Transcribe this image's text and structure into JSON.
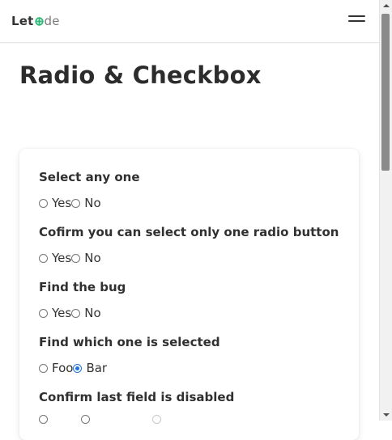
{
  "brand": {
    "part1": "Let",
    "part2": "de"
  },
  "page": {
    "title": "Radio & Checkbox"
  },
  "questions": [
    {
      "label": "Select any one",
      "options": [
        {
          "text": "Yes",
          "checked": false
        },
        {
          "text": "No",
          "checked": false
        }
      ]
    },
    {
      "label": "Cofirm you can select only one radio button",
      "options": [
        {
          "text": "Yes",
          "checked": false
        },
        {
          "text": "No",
          "checked": false
        }
      ]
    },
    {
      "label": "Find the bug",
      "options": [
        {
          "text": "Yes",
          "checked": false
        },
        {
          "text": "No",
          "checked": false
        }
      ]
    },
    {
      "label": "Find which one is selected",
      "options": [
        {
          "text": "Foo",
          "checked": false
        },
        {
          "text": "Bar",
          "checked": true
        }
      ]
    },
    {
      "label": "Confirm last field is disabled",
      "options": []
    }
  ],
  "colors": {
    "accent": "#1a73e8",
    "logo_mark": "#2bb673"
  },
  "icons": {
    "menu": "hamburger-menu-icon",
    "logo": "letcode-logo-icon"
  }
}
